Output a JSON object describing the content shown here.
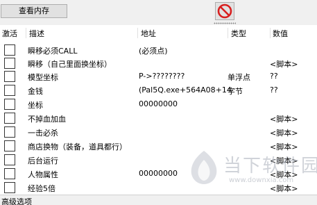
{
  "toolbar": {
    "view_memory_label": "查看内存",
    "delete_icon": "no-entry-icon"
  },
  "table": {
    "headers": {
      "active": "激活",
      "description": "描述",
      "address": "地址",
      "type": "类型",
      "value": "数值"
    },
    "rows": [
      {
        "description": "瞬移必须CALL",
        "address": "(必须点)",
        "type": "",
        "value": ""
      },
      {
        "description": "瞬移（自己里面换坐标）",
        "address": "",
        "type": "",
        "value": "<脚本>"
      },
      {
        "description": "模型坐标",
        "address": "P->????????",
        "type": "单浮点",
        "value": "??"
      },
      {
        "description": "金钱",
        "address": "(Pal5Q.exe+564A08+14",
        "type": "字节",
        "value": "??"
      },
      {
        "description": "坐标",
        "address": "00000000",
        "type": "",
        "value": ""
      },
      {
        "description": "不掉血加血",
        "address": "",
        "type": "",
        "value": "<脚本>"
      },
      {
        "description": "一击必杀",
        "address": "",
        "type": "",
        "value": "<脚本>"
      },
      {
        "description": "商店换物（装备，道具都行）",
        "address": "",
        "type": "",
        "value": "<脚本>"
      },
      {
        "description": "后台运行",
        "address": "",
        "type": "",
        "value": "<脚本>"
      },
      {
        "description": "人物属性",
        "address": "00000000",
        "type": "",
        "value": "<脚本>"
      },
      {
        "description": "经验5倍",
        "address": "",
        "type": "",
        "value": "<脚本>"
      }
    ]
  },
  "status": {
    "advanced_options": "高级选项"
  },
  "watermark": {
    "cn": "当下软件园",
    "en": "www.downxia.com"
  },
  "colors": {
    "delete_icon_red": "#d81e1e",
    "table_bg": "#ffffff",
    "window_bg": "#f0f0f0"
  }
}
